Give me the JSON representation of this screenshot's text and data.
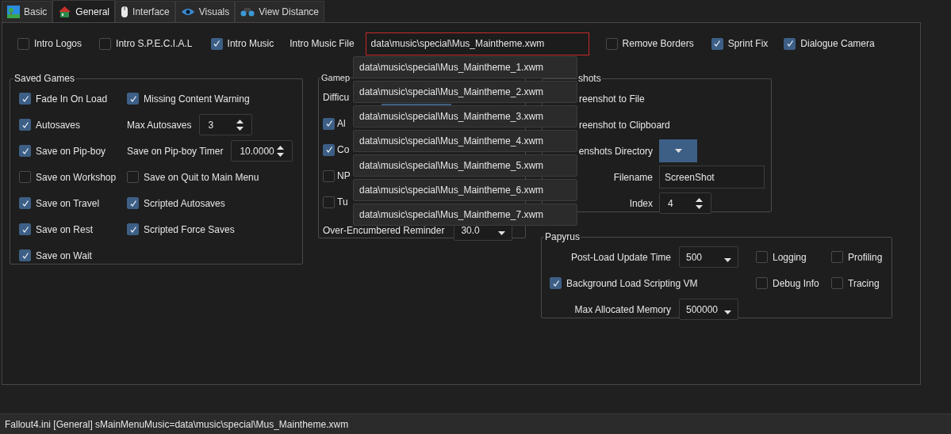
{
  "tabs": [
    {
      "label": "Basic",
      "selected": false
    },
    {
      "label": "General",
      "selected": true
    },
    {
      "label": "Interface",
      "selected": false
    },
    {
      "label": "Visuals",
      "selected": false
    },
    {
      "label": "View Distance",
      "selected": false
    }
  ],
  "top_row": [
    {
      "kind": "checkbox",
      "label": "Intro Logos",
      "checked": false
    },
    {
      "kind": "checkbox",
      "label": "Intro S.P.E.C.I.A.L",
      "checked": false
    },
    {
      "kind": "checkbox",
      "label": "Intro Music",
      "checked": true
    },
    {
      "kind": "field",
      "label": "Intro Music File",
      "value": "data\\music\\special\\Mus_Maintheme.xwm"
    },
    {
      "kind": "checkbox",
      "label": "Remove Borders",
      "checked": false
    },
    {
      "kind": "checkbox",
      "label": "Sprint Fix",
      "checked": true
    },
    {
      "kind": "checkbox",
      "label": "Dialogue Camera",
      "checked": true
    }
  ],
  "saved_games": {
    "title": "Saved Games",
    "items": [
      {
        "kind": "checkbox",
        "label": "Fade In On Load",
        "checked": true
      },
      {
        "kind": "checkbox",
        "label": "Missing Content Warning",
        "checked": true
      },
      {
        "kind": "checkbox",
        "label": "Autosaves",
        "checked": true
      },
      {
        "kind": "spin",
        "label": "Max Autosaves",
        "value": "3"
      },
      {
        "kind": "checkbox",
        "label": "Save on Pip-boy",
        "checked": true
      },
      {
        "kind": "spin",
        "label": "Save on Pip-boy Timer",
        "value": "10.0000"
      },
      {
        "kind": "checkbox",
        "label": "Save on Workshop",
        "checked": false
      },
      {
        "kind": "checkbox",
        "label": "Save on Quit to Main Menu",
        "checked": false
      },
      {
        "kind": "checkbox",
        "label": "Save on Travel",
        "checked": true
      },
      {
        "kind": "checkbox",
        "label": "Scripted Autosaves",
        "checked": true
      },
      {
        "kind": "checkbox",
        "label": "Save on Rest",
        "checked": true
      },
      {
        "kind": "checkbox",
        "label": "Scripted Force Saves",
        "checked": true
      },
      {
        "kind": "checkbox",
        "label": "Save on Wait",
        "checked": true
      }
    ]
  },
  "gameplay": {
    "title": "Gamep",
    "items": [
      {
        "kind": "combo",
        "label": "Difficu",
        "highlighted": true
      },
      {
        "kind": "checkbox",
        "label": "Al",
        "checked": true
      },
      {
        "kind": "checkbox",
        "label": "Co",
        "checked": true
      },
      {
        "kind": "checkbox",
        "label": "NP",
        "checked": false
      },
      {
        "kind": "checkbox",
        "label": "Tu",
        "checked": false
      },
      {
        "kind": "combo",
        "label": "Over-Encumbered Reminder",
        "value": "30.0",
        "highlighted": false
      }
    ]
  },
  "screenshots": {
    "title": "shots",
    "items": [
      {
        "kind": "text",
        "label": "reenshot to File"
      },
      {
        "kind": "text",
        "label": "reenshot to Clipboard"
      },
      {
        "kind": "dir",
        "label": "enshots Directory",
        "highlighted": true
      },
      {
        "kind": "field",
        "label": "Filename",
        "value": "ScreenShot"
      },
      {
        "kind": "spin",
        "label": "Index",
        "value": "4"
      }
    ]
  },
  "papyrus": {
    "title": "Papyrus",
    "items": [
      {
        "kind": "combo",
        "label": "Post-Load Update Time",
        "value": "500"
      },
      {
        "kind": "checkbox",
        "label": "Logging",
        "checked": false
      },
      {
        "kind": "checkbox",
        "label": "Profiling",
        "checked": false
      },
      {
        "kind": "wide_checkbox",
        "label": "Background Load Scripting VM",
        "checked": true
      },
      {
        "kind": "checkbox",
        "label": "Debug Info",
        "checked": false
      },
      {
        "kind": "checkbox",
        "label": "Tracing",
        "checked": false
      },
      {
        "kind": "combo",
        "label": "Max Allocated Memory",
        "value": "500000"
      }
    ]
  },
  "dropdown": {
    "items": [
      "data\\music\\special\\Mus_Maintheme_1.xwm",
      "data\\music\\special\\Mus_Maintheme_2.xwm",
      "data\\music\\special\\Mus_Maintheme_3.xwm",
      "data\\music\\special\\Mus_Maintheme_4.xwm",
      "data\\music\\special\\Mus_Maintheme_5.xwm",
      "data\\music\\special\\Mus_Maintheme_6.xwm",
      "data\\music\\special\\Mus_Maintheme_7.xwm"
    ]
  },
  "status_bar": "Fallout4.ini [General] sMainMenuMusic=data\\music\\special\\Mus_Maintheme.xwm"
}
